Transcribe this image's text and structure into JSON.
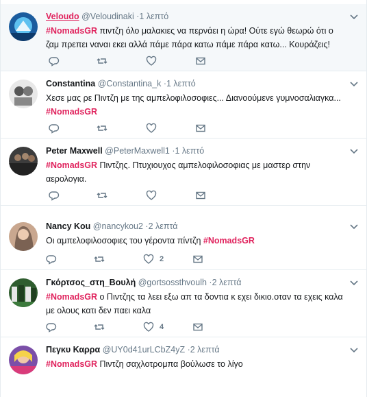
{
  "tweets": [
    {
      "name": "Veloudo",
      "handle": "@Veloudinaki",
      "dot": "·",
      "time": "1 λεπτό",
      "hashtag": "#NomadsGR",
      "text": " πιντζη όλο μαλακιες να περνάει η ώρα! Ούτε εγώ θεωρώ ότι ο ζαμ πρεπει ναναι εκει αλλά πάμε πάρα κατω πάμε πάρα κατω... Κουράζεις!",
      "likes": ""
    },
    {
      "name": "Constantina",
      "handle": "@Constantina_k",
      "dot": "·",
      "time": "1 λεπτό",
      "text": "Χεσε μας ρε Πιντζη με της αμπελοφιλοσοφιες... Διανοούμενε γυμνοσαλιαγκα...",
      "hashtag": "#NomadsGR",
      "likes": ""
    },
    {
      "name": "Peter Maxwell",
      "handle": "@PeterMaxwell1",
      "dot": "·",
      "time": "1 λεπτό",
      "hashtag": "#NomadsGR",
      "text": " Πιντζης. Πτυχιουχος αμπελοφιλοσοφιας με μαστερ στην αερολογια.",
      "likes": ""
    },
    {
      "name": "Nancy Kou",
      "handle": "@nancykou2",
      "dot": "·",
      "time": "2 λεπτά",
      "text": "Οι αμπελοφιλοσοφιες του γέροντα πίντζη ",
      "hashtag": "#NomadsGR",
      "likes": "2"
    },
    {
      "name": "Γκόρτσος_στη_Βουλή",
      "handle": "@gortsossthvoulh",
      "dot": "·",
      "time": "2 λεπτά",
      "hashtag": "#NomadsGR",
      "text": "  ο Πιντζης τα λεει εξω απ τα δοντια κ εχει δικιο.οταν τα εχεις καλα με ολους κατι δεν παει καλα",
      "likes": "4"
    },
    {
      "name": "Πεγκυ Καρρα",
      "handle": "@UY0d41urLCbZ4yZ",
      "dot": "·",
      "time": "2 λεπτά",
      "hashtag": "#NomadsGR",
      "text": " Πιντζη σαχλοτρομπα βούλωσε το λίγο",
      "likes": ""
    }
  ],
  "colors": {
    "accent": "#e0245e",
    "muted": "#657786",
    "text": "#14171a"
  },
  "icons": [
    "reply-icon",
    "retweet-icon",
    "like-icon",
    "message-icon",
    "chevron-down-icon"
  ]
}
